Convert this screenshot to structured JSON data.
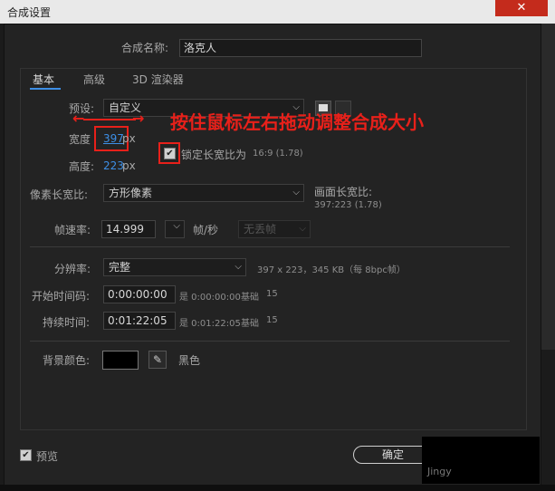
{
  "window": {
    "title": "合成设置",
    "close_glyph": "✕"
  },
  "name_row": {
    "label": "合成名称:",
    "value": "洛克人"
  },
  "tabs": [
    {
      "label": "基本",
      "active": true
    },
    {
      "label": "高级",
      "active": false
    },
    {
      "label": "3D 渲染器",
      "active": false
    }
  ],
  "preset": {
    "label": "预设:",
    "value": "自定义"
  },
  "width": {
    "label": "宽度",
    "value": "397",
    "unit": "px"
  },
  "height": {
    "label": "高度:",
    "value": "223",
    "unit": "px"
  },
  "lock_ratio": {
    "label": "锁定长宽比为",
    "ratio": "16:9 (1.78)",
    "checked": true
  },
  "annotation": {
    "text": "按住鼠标左右拖动调整合成大小",
    "arrow_left": "←",
    "arrow_right": "→"
  },
  "pixel_aspect": {
    "label": "像素长宽比:",
    "value": "方形像素"
  },
  "frame_aspect": {
    "label": "画面长宽比:",
    "value": "397:223 (1.78)"
  },
  "frame_rate": {
    "label": "帧速率:",
    "value": "14.999",
    "unit": "帧/秒",
    "drop_frame": "无丢帧"
  },
  "resolution": {
    "label": "分辨率:",
    "value": "完整",
    "info": "397 x 223，345 KB（每 8bpc帧）"
  },
  "start_timecode": {
    "label": "开始时间码:",
    "value": "0:00:00:00",
    "eq": "是 0:00:00:00",
    "base_label": "基础",
    "base_value": "15"
  },
  "duration": {
    "label": "持续时间:",
    "value": "0:01:22:05",
    "eq": "是 0:01:22:05",
    "base_label": "基础",
    "base_value": "15"
  },
  "background": {
    "label": "背景颜色:",
    "color_name": "黑色",
    "swatch_color": "#000000"
  },
  "preview": {
    "label": "预览",
    "checked": true
  },
  "ok_button": {
    "label": "确定"
  },
  "watermark": {
    "text": "Jingy"
  },
  "colors": {
    "accent_link": "#3d8fe6",
    "annotation_red": "#e8201a"
  }
}
